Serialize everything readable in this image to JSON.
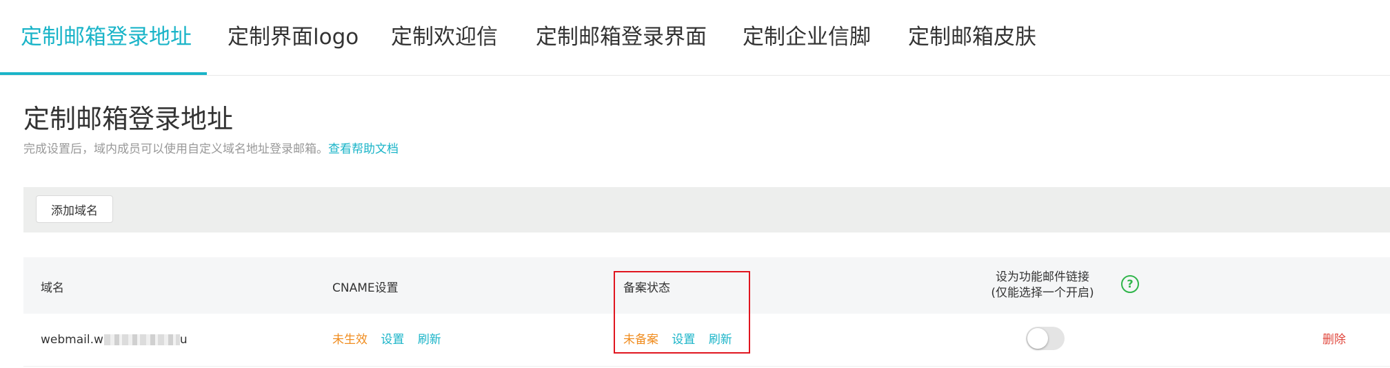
{
  "tabs": [
    {
      "label": "定制邮箱登录地址",
      "active": true
    },
    {
      "label": "定制界面logo",
      "active": false
    },
    {
      "label": "定制欢迎信",
      "active": false
    },
    {
      "label": "定制邮箱登录界面",
      "active": false
    },
    {
      "label": "定制企业信脚",
      "active": false
    },
    {
      "label": "定制邮箱皮肤",
      "active": false
    }
  ],
  "page": {
    "title": "定制邮箱登录地址",
    "description": "完成设置后，域内成员可以使用自定义域名地址登录邮箱。",
    "help_link": "查看帮助文档"
  },
  "toolbar": {
    "add_domain_label": "添加域名"
  },
  "table": {
    "headers": {
      "domain": "域名",
      "cname": "CNAME设置",
      "icp": "备案状态",
      "function_link_line1": "设为功能邮件链接",
      "function_link_line2": "(仅能选择一个开启)",
      "help_icon": "?"
    },
    "rows": [
      {
        "domain": "webmail.w",
        "domain_suffix": "u",
        "cname_status": "未生效",
        "cname_set": "设置",
        "cname_refresh": "刷新",
        "icp_status": "未备案",
        "icp_set": "设置",
        "icp_refresh": "刷新",
        "function_link_enabled": false,
        "delete": "删除"
      }
    ]
  },
  "colors": {
    "accent": "#1ab4c8",
    "warning": "#f08c1e",
    "danger": "#e0463c",
    "help_icon": "#2fb54a",
    "highlight": "#e0141e"
  },
  "icons": {
    "help": "question-circle-icon"
  }
}
